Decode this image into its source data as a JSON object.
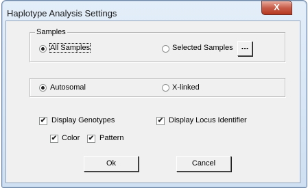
{
  "window": {
    "title": "Haplotype Analysis Settings",
    "close_glyph": "X"
  },
  "samples_group": {
    "legend": "Samples",
    "all_samples": {
      "label": "All Samples",
      "selected": true
    },
    "selected_samples": {
      "label": "Selected Samples",
      "selected": false
    },
    "browse_label": "..."
  },
  "chromosome_group": {
    "autosomal": {
      "label": "Autosomal",
      "selected": true
    },
    "x_linked": {
      "label": "X-linked",
      "selected": false
    }
  },
  "options": {
    "display_genotypes": {
      "label": "Display Genotypes",
      "checked": true
    },
    "display_locus_identifier": {
      "label": "Display Locus Identifier",
      "checked": true
    },
    "color": {
      "label": "Color",
      "checked": true
    },
    "pattern": {
      "label": "Pattern",
      "checked": true
    }
  },
  "buttons": {
    "ok": "Ok",
    "cancel": "Cancel"
  },
  "check_glyph": "✔"
}
